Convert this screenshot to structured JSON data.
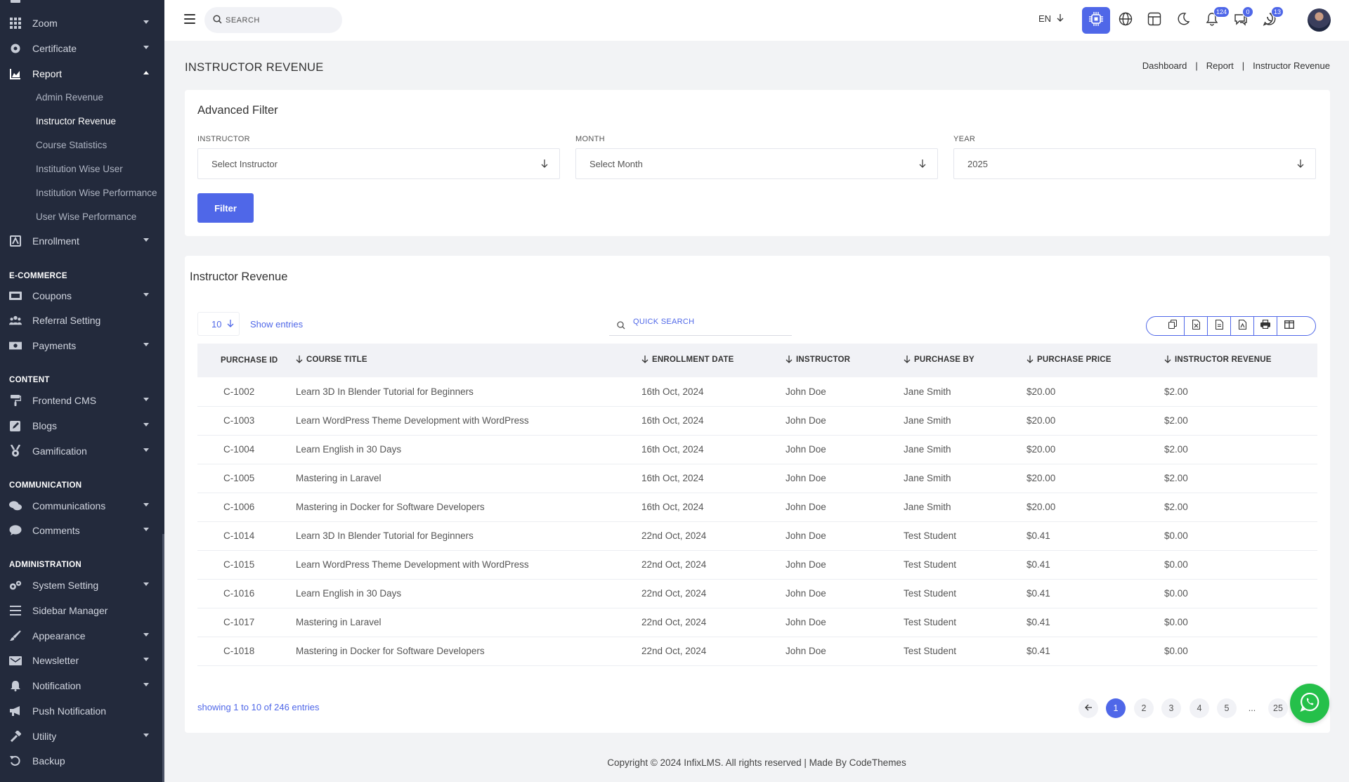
{
  "header": {
    "search_placeholder": "SEARCH",
    "language": "EN",
    "notifications_count": "124",
    "messages_count": "0",
    "chat_count": "13",
    "accent_color": "#4f67e8"
  },
  "sidebar": {
    "items": [
      {
        "label": "Zoom",
        "icon": "grid-icon"
      },
      {
        "label": "Certificate",
        "icon": "certificate-icon"
      },
      {
        "label": "Report",
        "icon": "chart-icon"
      },
      {
        "label": "Enrollment",
        "icon": "enrollment-icon"
      }
    ],
    "report_sub": [
      {
        "label": "Admin Revenue"
      },
      {
        "label": "Instructor Revenue"
      },
      {
        "label": "Course Statistics"
      },
      {
        "label": "Institution Wise User"
      },
      {
        "label": "Institution Wise Performance"
      },
      {
        "label": "User Wise Performance"
      }
    ],
    "ecommerce_title": "E-COMMERCE",
    "ecommerce": [
      {
        "label": "Coupons"
      },
      {
        "label": "Referral Setting"
      },
      {
        "label": "Payments"
      }
    ],
    "content_title": "CONTENT",
    "content": [
      {
        "label": "Frontend CMS"
      },
      {
        "label": "Blogs"
      },
      {
        "label": "Gamification"
      }
    ],
    "communication_title": "COMMUNICATION",
    "communication": [
      {
        "label": "Communications"
      },
      {
        "label": "Comments"
      }
    ],
    "administration_title": "ADMINISTRATION",
    "administration": [
      {
        "label": "System Setting"
      },
      {
        "label": "Sidebar Manager"
      },
      {
        "label": "Appearance"
      },
      {
        "label": "Newsletter"
      },
      {
        "label": "Notification"
      },
      {
        "label": "Push Notification"
      },
      {
        "label": "Utility"
      },
      {
        "label": "Backup"
      }
    ]
  },
  "page": {
    "title": "INSTRUCTOR REVENUE",
    "breadcrumb": [
      "Dashboard",
      "Report",
      "Instructor Revenue"
    ]
  },
  "filter": {
    "title": "Advanced Filter",
    "instructor_label": "INSTRUCTOR",
    "instructor_value": "Select Instructor",
    "month_label": "MONTH",
    "month_value": "Select Month",
    "year_label": "YEAR",
    "year_value": "2025",
    "button": "Filter"
  },
  "table": {
    "title": "Instructor Revenue",
    "page_size": "10",
    "show_entries": "Show entries",
    "search_placeholder": "QUICK SEARCH",
    "columns": [
      "PURCHASE ID",
      "COURSE TITLE",
      "ENROLLMENT DATE",
      "INSTRUCTOR",
      "PURCHASE BY",
      "PURCHASE PRICE",
      "INSTRUCTOR REVENUE"
    ],
    "rows": [
      [
        "C-1002",
        "Learn 3D In Blender Tutorial for Beginners",
        "16th Oct, 2024",
        "John Doe",
        "Jane Smith",
        "$20.00",
        "$2.00"
      ],
      [
        "C-1003",
        "Learn WordPress Theme Development with WordPress",
        "16th Oct, 2024",
        "John Doe",
        "Jane Smith",
        "$20.00",
        "$2.00"
      ],
      [
        "C-1004",
        "Learn English in 30 Days",
        "16th Oct, 2024",
        "John Doe",
        "Jane Smith",
        "$20.00",
        "$2.00"
      ],
      [
        "C-1005",
        "Mastering in Laravel",
        "16th Oct, 2024",
        "John Doe",
        "Jane Smith",
        "$20.00",
        "$2.00"
      ],
      [
        "C-1006",
        "Mastering in Docker for Software Developers",
        "16th Oct, 2024",
        "John Doe",
        "Jane Smith",
        "$20.00",
        "$2.00"
      ],
      [
        "C-1014",
        "Learn 3D In Blender Tutorial for Beginners",
        "22nd Oct, 2024",
        "John Doe",
        "Test Student",
        "$0.41",
        "$0.00"
      ],
      [
        "C-1015",
        "Learn WordPress Theme Development with WordPress",
        "22nd Oct, 2024",
        "John Doe",
        "Test Student",
        "$0.41",
        "$0.00"
      ],
      [
        "C-1016",
        "Learn English in 30 Days",
        "22nd Oct, 2024",
        "John Doe",
        "Test Student",
        "$0.41",
        "$0.00"
      ],
      [
        "C-1017",
        "Mastering in Laravel",
        "22nd Oct, 2024",
        "John Doe",
        "Test Student",
        "$0.41",
        "$0.00"
      ],
      [
        "C-1018",
        "Mastering in Docker for Software Developers",
        "22nd Oct, 2024",
        "John Doe",
        "Test Student",
        "$0.41",
        "$0.00"
      ]
    ],
    "showing": "showing 1 to 10 of 246 entries",
    "pages": [
      "1",
      "2",
      "3",
      "4",
      "5",
      "...",
      "25"
    ]
  },
  "footer": {
    "text": "Copyright © 2024 InfixLMS. All rights reserved | Made By CodeThemes"
  }
}
